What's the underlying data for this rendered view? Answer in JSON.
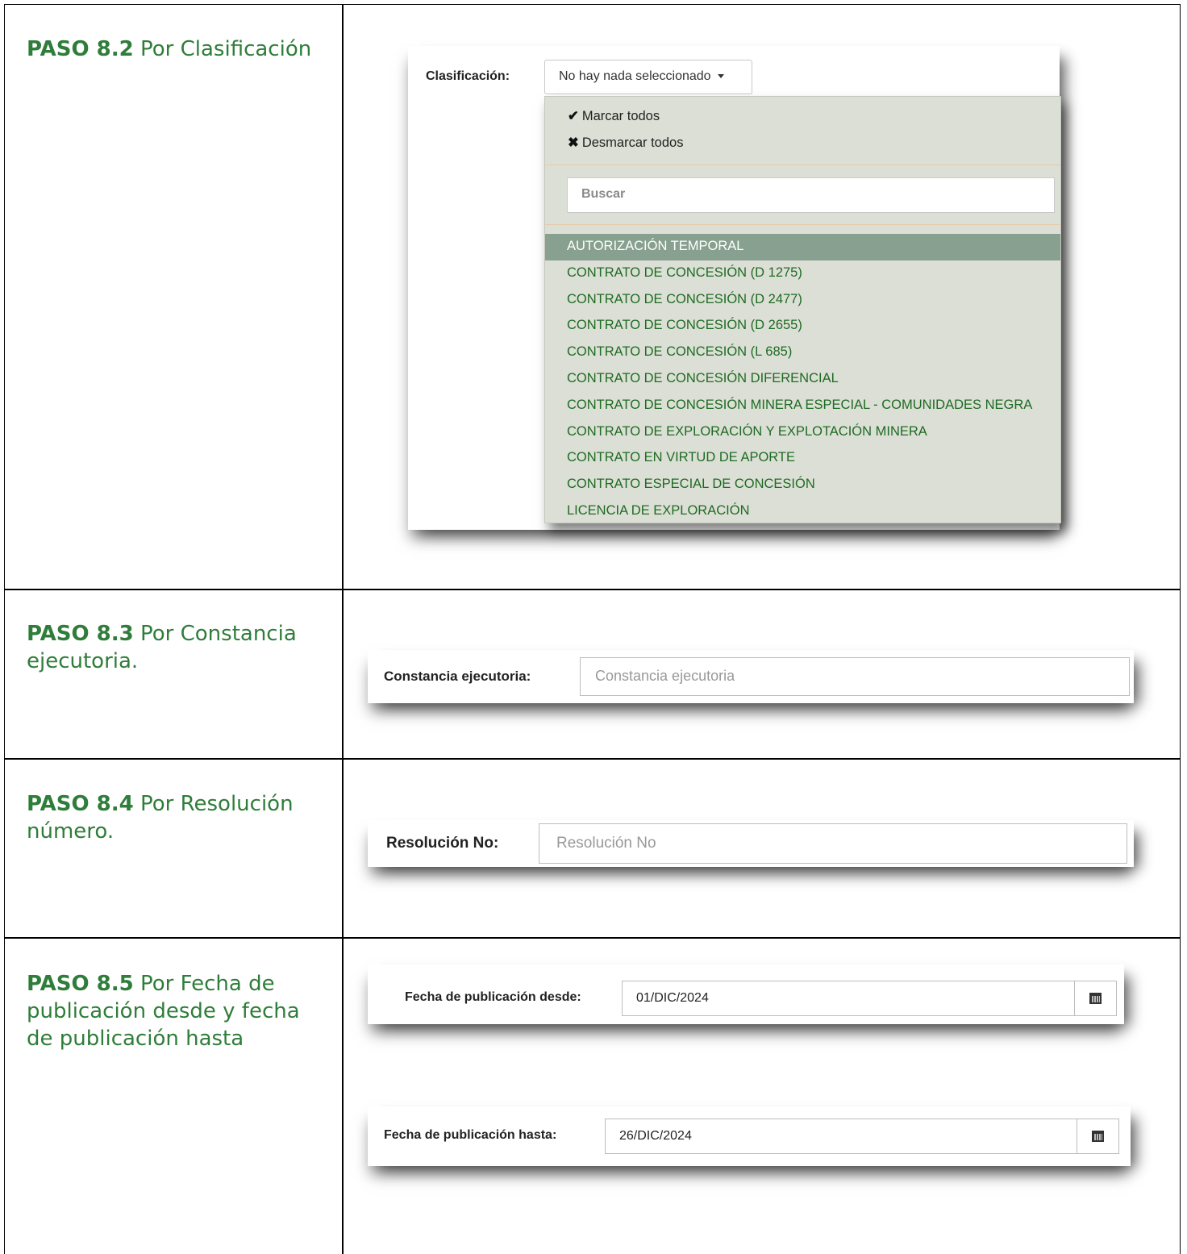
{
  "steps": [
    {
      "bold": "PASO 8.2",
      "text": " Por Clasificación"
    },
    {
      "bold": "PASO 8.3",
      "text": " Por Constancia ejecutoria."
    },
    {
      "bold": "PASO 8.4",
      "text": " Por Resolución número."
    },
    {
      "bold": "PASO 8.5",
      "text": " Por Fecha de publicación desde y fecha de publicación hasta"
    }
  ],
  "clasificacion": {
    "label": "Clasificación:",
    "button_text": "No hay nada seleccionado",
    "select_all": "Marcar todos",
    "deselect_all": "Desmarcar todos",
    "search_placeholder": "Buscar",
    "options": [
      "AUTORIZACIÓN TEMPORAL",
      "CONTRATO DE CONCESIÓN (D 1275)",
      "CONTRATO DE CONCESIÓN (D 2477)",
      "CONTRATO DE CONCESIÓN (D 2655)",
      "CONTRATO DE CONCESIÓN (L 685)",
      "CONTRATO DE CONCESIÓN DIFERENCIAL",
      "CONTRATO DE CONCESIÓN MINERA ESPECIAL - COMUNIDADES NEGRA",
      "CONTRATO DE EXPLORACIÓN Y EXPLOTACIÓN MINERA",
      "CONTRATO EN VIRTUD DE APORTE",
      "CONTRATO ESPECIAL DE CONCESIÓN",
      "LICENCIA DE EXPLORACIÓN"
    ],
    "highlighted_index": 0
  },
  "constancia": {
    "label": "Constancia ejecutoria:",
    "placeholder": "Constancia ejecutoria"
  },
  "resolucion": {
    "label": "Resolución No:",
    "placeholder": "Resolución No"
  },
  "fecha_desde": {
    "label": "Fecha de publicación desde:",
    "value": "01/DIC/2024"
  },
  "fecha_hasta": {
    "label": "Fecha de publicación hasta:",
    "value": "26/DIC/2024"
  },
  "icons": {
    "check": "check-icon",
    "times": "times-icon",
    "calendar": "calendar-icon",
    "caret": "caret-down-icon"
  }
}
